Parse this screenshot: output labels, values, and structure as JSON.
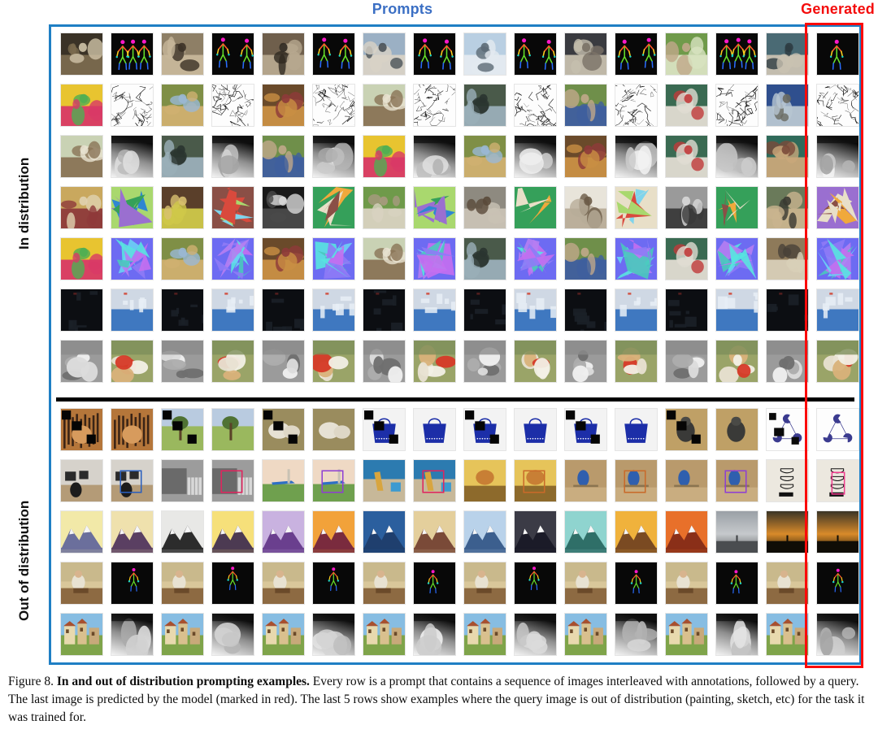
{
  "headers": {
    "prompts": "Prompts",
    "generated": "Generated",
    "prompts_color": "#3b6fc4",
    "generated_color": "#f40d0d"
  },
  "side_labels": {
    "in_distribution": "In distribution",
    "out_of_distribution": "Out of distribution"
  },
  "frame": {
    "border_color": "#1f7fc4",
    "generated_border_color": "#fb0a0a",
    "columns": 16,
    "prompt_columns": 15,
    "generated_columns": 1
  },
  "caption": {
    "figure_number": "Figure 8.",
    "bold_title": "In and out of distribution prompting examples.",
    "body": "Every row is a prompt that contains a sequence of images interleaved with annotations, followed by a query. The last image is predicted by the model (marked in red). The last 5 rows show examples where the query image is out of distribution (painting, sketch, etc) for the task it was trained for."
  },
  "grid": {
    "in_distribution": [
      {
        "task": "human-pose-estimation",
        "tiles": [
          {
            "kind": "photo-interior-group",
            "label": "photo"
          },
          {
            "kind": "pose-skeleton-3",
            "label": "pose"
          },
          {
            "kind": "photo-two-people-hall",
            "label": "photo"
          },
          {
            "kind": "pose-skeleton-2",
            "label": "pose"
          },
          {
            "kind": "photo-corridor-pair",
            "label": "photo"
          },
          {
            "kind": "pose-skeleton-2b",
            "label": "pose"
          },
          {
            "kind": "photo-car-couple",
            "label": "photo"
          },
          {
            "kind": "pose-skeleton-2c",
            "label": "pose"
          },
          {
            "kind": "photo-bikers-sky",
            "label": "photo"
          },
          {
            "kind": "pose-skeleton-wide",
            "label": "pose"
          },
          {
            "kind": "photo-two-men-suits",
            "label": "photo"
          },
          {
            "kind": "pose-skeleton-2d",
            "label": "pose"
          },
          {
            "kind": "photo-couple-garden",
            "label": "photo"
          },
          {
            "kind": "pose-skeleton-3b",
            "label": "pose"
          },
          {
            "kind": "photo-office-handshake",
            "label": "query"
          },
          {
            "kind": "pose-skeleton-gen",
            "label": "generated"
          }
        ]
      },
      {
        "task": "edge-detection",
        "tiles": [
          {
            "kind": "photo-bento-box",
            "label": "photo"
          },
          {
            "kind": "edges-bento",
            "label": "edges"
          },
          {
            "kind": "photo-giraffe-field",
            "label": "photo"
          },
          {
            "kind": "edges-giraffe",
            "label": "edges"
          },
          {
            "kind": "photo-giraffe-person",
            "label": "photo"
          },
          {
            "kind": "edges-giraffe-person",
            "label": "edges"
          },
          {
            "kind": "photo-vase-room",
            "label": "photo"
          },
          {
            "kind": "edges-vase",
            "label": "edges"
          },
          {
            "kind": "photo-lake-tree",
            "label": "photo"
          },
          {
            "kind": "edges-lake",
            "label": "edges"
          },
          {
            "kind": "photo-man-cap",
            "label": "photo"
          },
          {
            "kind": "edges-man-cap",
            "label": "edges"
          },
          {
            "kind": "photo-dog-bed",
            "label": "photo"
          },
          {
            "kind": "edges-dog-bed",
            "label": "edges"
          },
          {
            "kind": "photo-bus-street",
            "label": "query"
          },
          {
            "kind": "edges-bus-gen",
            "label": "generated"
          }
        ]
      },
      {
        "task": "depth-estimation",
        "tiles": [
          {
            "kind": "photo-vase-room",
            "label": "photo"
          },
          {
            "kind": "depth-vase",
            "label": "depth"
          },
          {
            "kind": "photo-lake-tree",
            "label": "photo"
          },
          {
            "kind": "depth-lake",
            "label": "depth"
          },
          {
            "kind": "photo-man-cap",
            "label": "photo"
          },
          {
            "kind": "depth-man",
            "label": "depth"
          },
          {
            "kind": "photo-bento-box",
            "label": "photo"
          },
          {
            "kind": "depth-bento",
            "label": "depth"
          },
          {
            "kind": "photo-giraffe-field",
            "label": "photo"
          },
          {
            "kind": "depth-giraffe",
            "label": "depth"
          },
          {
            "kind": "photo-giraffe-person",
            "label": "photo"
          },
          {
            "kind": "depth-giraffe-person",
            "label": "depth"
          },
          {
            "kind": "photo-dog-bed",
            "label": "photo"
          },
          {
            "kind": "depth-dog-bed",
            "label": "depth"
          },
          {
            "kind": "photo-crowd-shop",
            "label": "query"
          },
          {
            "kind": "depth-crowd-gen",
            "label": "generated"
          }
        ]
      },
      {
        "task": "semantic-segmentation",
        "tiles": [
          {
            "kind": "photo-statue-throne",
            "label": "photo"
          },
          {
            "kind": "seg-statue",
            "label": "segmentation"
          },
          {
            "kind": "photo-pear-bottle",
            "label": "photo"
          },
          {
            "kind": "seg-pear",
            "label": "segmentation"
          },
          {
            "kind": "photo-stove-top",
            "label": "photo"
          },
          {
            "kind": "seg-stove",
            "label": "segmentation"
          },
          {
            "kind": "photo-sheep-grass",
            "label": "photo"
          },
          {
            "kind": "seg-sheep",
            "label": "segmentation"
          },
          {
            "kind": "photo-goat-rock",
            "label": "photo"
          },
          {
            "kind": "seg-goat",
            "label": "segmentation"
          },
          {
            "kind": "photo-white-dog",
            "label": "photo"
          },
          {
            "kind": "seg-white-dog",
            "label": "segmentation"
          },
          {
            "kind": "photo-old-group",
            "label": "photo"
          },
          {
            "kind": "seg-old-group",
            "label": "segmentation"
          },
          {
            "kind": "photo-dog-wall",
            "label": "query"
          },
          {
            "kind": "seg-dog-gen",
            "label": "generated"
          }
        ]
      },
      {
        "task": "surface-normals",
        "tiles": [
          {
            "kind": "photo-bento-box",
            "label": "photo"
          },
          {
            "kind": "normals-bento",
            "label": "normals"
          },
          {
            "kind": "photo-giraffe-field",
            "label": "photo"
          },
          {
            "kind": "normals-giraffe",
            "label": "normals"
          },
          {
            "kind": "photo-giraffe-person",
            "label": "photo"
          },
          {
            "kind": "normals-giraffe-person",
            "label": "normals"
          },
          {
            "kind": "photo-vase-room",
            "label": "photo"
          },
          {
            "kind": "normals-vase",
            "label": "normals"
          },
          {
            "kind": "photo-lake-tree",
            "label": "photo"
          },
          {
            "kind": "normals-lake",
            "label": "normals"
          },
          {
            "kind": "photo-man-cap",
            "label": "photo"
          },
          {
            "kind": "normals-man",
            "label": "normals"
          },
          {
            "kind": "photo-dog-bed",
            "label": "photo"
          },
          {
            "kind": "normals-dog-bed",
            "label": "normals"
          },
          {
            "kind": "photo-shelf-room",
            "label": "query"
          },
          {
            "kind": "normals-shelf-gen",
            "label": "generated"
          }
        ]
      },
      {
        "task": "low-light-enhancement",
        "tiles": [
          {
            "kind": "dark-corridor",
            "label": "dark"
          },
          {
            "kind": "bright-corridor",
            "label": "enhanced"
          },
          {
            "kind": "dark-bowling",
            "label": "dark"
          },
          {
            "kind": "bright-bowling",
            "label": "enhanced"
          },
          {
            "kind": "dark-cloth",
            "label": "dark"
          },
          {
            "kind": "bright-cloth",
            "label": "enhanced"
          },
          {
            "kind": "dark-pool",
            "label": "dark"
          },
          {
            "kind": "bright-pool",
            "label": "enhanced"
          },
          {
            "kind": "dark-shelf",
            "label": "dark"
          },
          {
            "kind": "bright-shelf",
            "label": "enhanced"
          },
          {
            "kind": "dark-room2",
            "label": "dark"
          },
          {
            "kind": "bright-room2",
            "label": "enhanced"
          },
          {
            "kind": "dark-flowers",
            "label": "dark"
          },
          {
            "kind": "bright-flowers",
            "label": "enhanced"
          },
          {
            "kind": "dark-pink-dress",
            "label": "query"
          },
          {
            "kind": "bright-pink-dress-gen",
            "label": "generated"
          }
        ]
      },
      {
        "task": "colorization",
        "tiles": [
          {
            "kind": "gray-sheep",
            "label": "grayscale"
          },
          {
            "kind": "color-sheep",
            "label": "colorized"
          },
          {
            "kind": "gray-peaches",
            "label": "grayscale"
          },
          {
            "kind": "color-peaches",
            "label": "colorized"
          },
          {
            "kind": "gray-poinsettia",
            "label": "grayscale"
          },
          {
            "kind": "color-poinsettia",
            "label": "colorized"
          },
          {
            "kind": "gray-magpie",
            "label": "grayscale"
          },
          {
            "kind": "color-magpie",
            "label": "colorized"
          },
          {
            "kind": "gray-lily",
            "label": "grayscale"
          },
          {
            "kind": "color-lily",
            "label": "colorized"
          },
          {
            "kind": "gray-cat",
            "label": "grayscale"
          },
          {
            "kind": "color-cat",
            "label": "colorized"
          },
          {
            "kind": "gray-puppy",
            "label": "grayscale"
          },
          {
            "kind": "color-puppy",
            "label": "colorized"
          },
          {
            "kind": "gray-shepherd",
            "label": "query"
          },
          {
            "kind": "color-shepherd-gen",
            "label": "generated"
          }
        ]
      }
    ],
    "out_of_distribution": [
      {
        "task": "inpainting",
        "tiles": [
          {
            "kind": "masked-tiger",
            "label": "masked"
          },
          {
            "kind": "inpaint-tiger",
            "label": "inpainted"
          },
          {
            "kind": "masked-tree",
            "label": "masked"
          },
          {
            "kind": "inpaint-tree",
            "label": "inpainted"
          },
          {
            "kind": "masked-sheep",
            "label": "masked"
          },
          {
            "kind": "inpaint-sheep",
            "label": "inpainted"
          },
          {
            "kind": "masked-bag",
            "label": "masked"
          },
          {
            "kind": "inpaint-bag",
            "label": "inpainted"
          },
          {
            "kind": "masked-bag2",
            "label": "masked"
          },
          {
            "kind": "inpaint-bag2",
            "label": "inpainted"
          },
          {
            "kind": "masked-bag3",
            "label": "masked"
          },
          {
            "kind": "inpaint-bag3",
            "label": "inpainted"
          },
          {
            "kind": "masked-dog-field",
            "label": "masked"
          },
          {
            "kind": "inpaint-dog-field",
            "label": "inpainted"
          },
          {
            "kind": "masked-kanizsa",
            "label": "query"
          },
          {
            "kind": "inpaint-kanizsa-gen",
            "label": "generated"
          }
        ]
      },
      {
        "task": "object-detection",
        "tiles": [
          {
            "kind": "office-desk",
            "label": "photo"
          },
          {
            "kind": "office-desk-box",
            "label": "detection"
          },
          {
            "kind": "bw-train-people",
            "label": "photo"
          },
          {
            "kind": "bw-train-people-box",
            "label": "detection"
          },
          {
            "kind": "airplane-field",
            "label": "photo"
          },
          {
            "kind": "airplane-field-box",
            "label": "detection"
          },
          {
            "kind": "giraffe-mural",
            "label": "photo"
          },
          {
            "kind": "giraffe-mural-box",
            "label": "detection"
          },
          {
            "kind": "yellow-scene",
            "label": "photo"
          },
          {
            "kind": "yellow-scene-box",
            "label": "detection"
          },
          {
            "kind": "skate-ramp",
            "label": "photo"
          },
          {
            "kind": "skate-ramp-box",
            "label": "detection"
          },
          {
            "kind": "skate-ramp2",
            "label": "photo"
          },
          {
            "kind": "skate-ramp2-box",
            "label": "detection"
          },
          {
            "kind": "cup-sketch",
            "label": "query"
          },
          {
            "kind": "cup-sketch-box-gen",
            "label": "generated"
          }
        ]
      },
      {
        "task": "style-mountains",
        "tiles": [
          {
            "kind": "mountain-blue",
            "label": "painting"
          },
          {
            "kind": "mountain-purple",
            "label": "painting"
          },
          {
            "kind": "mountain-bw",
            "label": "painting"
          },
          {
            "kind": "mountain-yellow",
            "label": "painting"
          },
          {
            "kind": "mountain-violet",
            "label": "painting"
          },
          {
            "kind": "mountain-red",
            "label": "painting"
          },
          {
            "kind": "mountain-navy",
            "label": "painting"
          },
          {
            "kind": "mountain-brown",
            "label": "painting"
          },
          {
            "kind": "mountain-blue2",
            "label": "painting"
          },
          {
            "kind": "mountain-dark",
            "label": "painting"
          },
          {
            "kind": "mountain-teal",
            "label": "painting"
          },
          {
            "kind": "mountain-amber",
            "label": "painting"
          },
          {
            "kind": "mountain-orange",
            "label": "painting"
          },
          {
            "kind": "skyline-gray",
            "label": "query"
          },
          {
            "kind": "skyline-sunset",
            "label": "painting"
          },
          {
            "kind": "skyline-sunset-gen",
            "label": "generated"
          }
        ]
      },
      {
        "task": "pose-on-paintings",
        "tiles": [
          {
            "kind": "painting-woman-table",
            "label": "painting"
          },
          {
            "kind": "pose-painting-1",
            "label": "pose"
          },
          {
            "kind": "painting-woman-hat",
            "label": "painting"
          },
          {
            "kind": "pose-painting-2",
            "label": "pose"
          },
          {
            "kind": "painting-man-jugs",
            "label": "painting"
          },
          {
            "kind": "pose-painting-3",
            "label": "pose"
          },
          {
            "kind": "painting-two-women",
            "label": "painting"
          },
          {
            "kind": "pose-painting-4",
            "label": "pose"
          },
          {
            "kind": "painting-interior",
            "label": "painting"
          },
          {
            "kind": "pose-painting-5",
            "label": "pose"
          },
          {
            "kind": "painting-group",
            "label": "painting"
          },
          {
            "kind": "pose-painting-6",
            "label": "pose"
          },
          {
            "kind": "painting-lady",
            "label": "painting"
          },
          {
            "kind": "pose-painting-7",
            "label": "pose"
          },
          {
            "kind": "painting-seated",
            "label": "query"
          },
          {
            "kind": "pose-painting-gen",
            "label": "generated"
          }
        ]
      },
      {
        "task": "depth-on-paintings",
        "tiles": [
          {
            "kind": "painting-village",
            "label": "painting"
          },
          {
            "kind": "depth-village",
            "label": "depth"
          },
          {
            "kind": "painting-hilltown",
            "label": "painting"
          },
          {
            "kind": "depth-hilltown",
            "label": "depth"
          },
          {
            "kind": "painting-alley",
            "label": "painting"
          },
          {
            "kind": "depth-alley",
            "label": "depth"
          },
          {
            "kind": "painting-dog-street",
            "label": "painting"
          },
          {
            "kind": "depth-dog-street",
            "label": "depth"
          },
          {
            "kind": "painting-house",
            "label": "painting"
          },
          {
            "kind": "depth-house",
            "label": "depth"
          },
          {
            "kind": "painting-green-field",
            "label": "painting"
          },
          {
            "kind": "depth-green-field",
            "label": "depth"
          },
          {
            "kind": "painting-farm",
            "label": "painting"
          },
          {
            "kind": "depth-farm",
            "label": "depth"
          },
          {
            "kind": "painting-tower",
            "label": "query"
          },
          {
            "kind": "depth-tower-gen",
            "label": "generated"
          }
        ]
      }
    ]
  }
}
